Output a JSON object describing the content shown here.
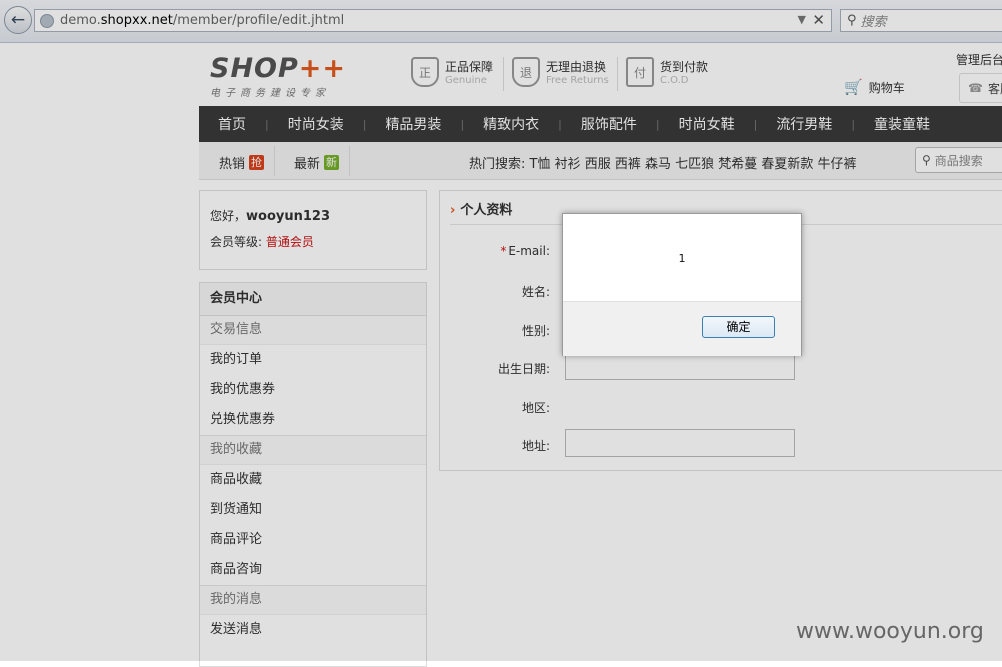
{
  "browser": {
    "url_prefix": "demo.",
    "url_domain": "shopxx.net",
    "url_path": "/member/profile/edit.jhtml",
    "search_placeholder": "搜索"
  },
  "header": {
    "logo_main": "SHOP",
    "logo_plus": "++",
    "logo_sub": "电子商务建设专家",
    "guarantees": [
      {
        "title": "正品保障",
        "sub": "Genuine",
        "icon_char": "正"
      },
      {
        "title": "无理由退换",
        "sub": "Free Returns",
        "icon_char": "退"
      },
      {
        "title": "货到付款",
        "sub": "C.O.D",
        "icon_char": "付"
      }
    ],
    "admin_link": "管理后台",
    "cart_label": "购物车",
    "customer_service": "客服"
  },
  "nav": {
    "items": [
      "首页",
      "时尚女装",
      "精品男装",
      "精致内衣",
      "服饰配件",
      "时尚女鞋",
      "流行男鞋",
      "童装童鞋"
    ]
  },
  "subnav": {
    "hot_label": "热销",
    "hot_tag": "抢",
    "new_label": "最新",
    "new_tag": "新",
    "hot_search": "热门搜索: T恤 衬衫 西服 西裤 森马 七匹狼 梵希蔓 春夏新款 牛仔裤",
    "search_placeholder": "商品搜索"
  },
  "user": {
    "greeting": "您好，",
    "username": "wooyun123",
    "level_label": "会员等级: ",
    "level_value": "普通会员"
  },
  "member_center": {
    "title": "会员中心",
    "groups": [
      {
        "title": "交易信息",
        "items": [
          "我的订单",
          "我的优惠券",
          "兑换优惠券"
        ]
      },
      {
        "title": "我的收藏",
        "items": [
          "商品收藏",
          "到货通知",
          "商品评论",
          "商品咨询"
        ]
      },
      {
        "title": "我的消息",
        "items": [
          "发送消息"
        ]
      }
    ]
  },
  "profile": {
    "title": "个人资料",
    "fields": {
      "email": "E-mail:",
      "name": "姓名:",
      "gender": "性别:",
      "birth": "出生日期:",
      "area": "地区:",
      "address": "地址:"
    }
  },
  "dialog": {
    "message": "1",
    "ok_label": "确定"
  },
  "watermark": "www.wooyun.org"
}
